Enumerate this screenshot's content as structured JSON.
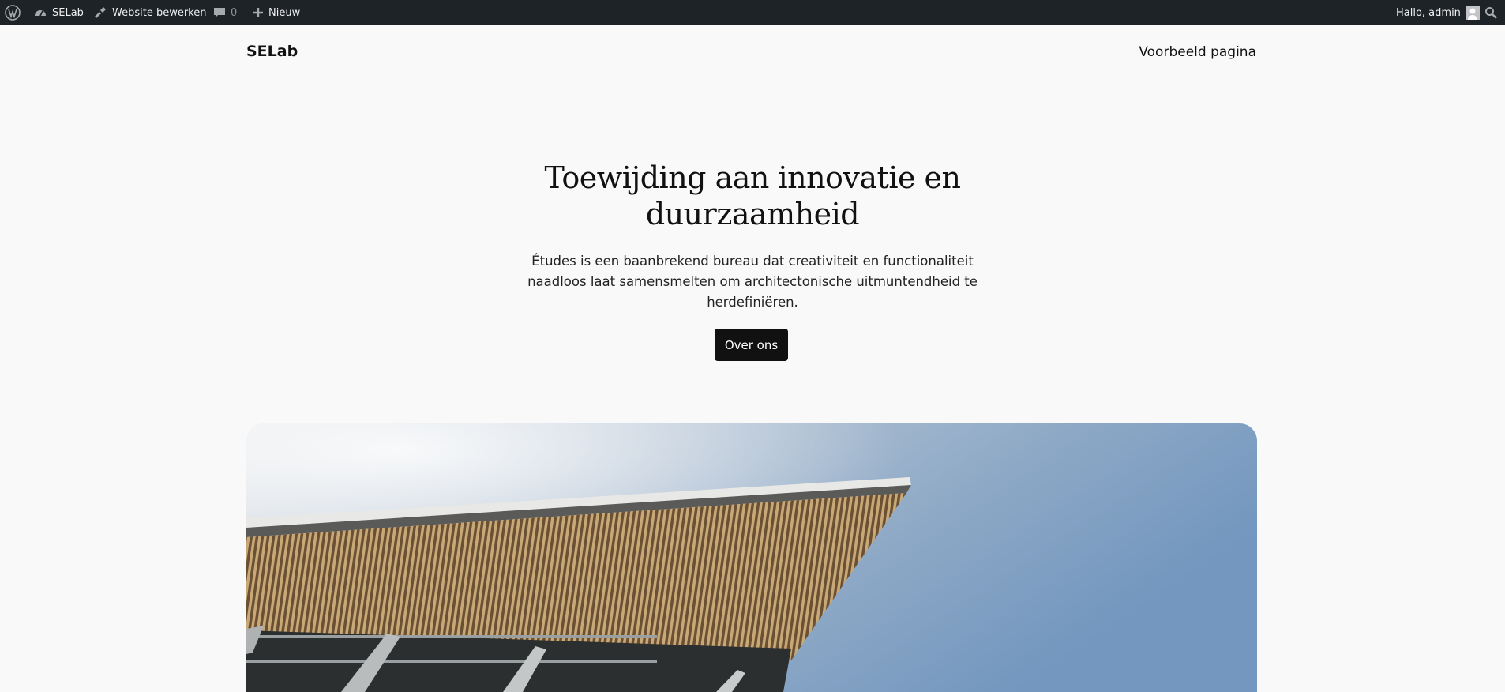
{
  "adminbar": {
    "site_name": "SELab",
    "edit_label": "Website bewerken",
    "comments_count": "0",
    "new_label": "Nieuw",
    "greeting": "Hallo, admin"
  },
  "header": {
    "site_title": "SELab",
    "nav_items": [
      "Voorbeeld pagina"
    ]
  },
  "hero": {
    "title": "Toewijding aan innovatie en duurzaamheid",
    "text": "Études is een baanbrekend bureau dat creativiteit en functionaliteit naadloos laat samensmelten om architectonische uitmuntendheid te herdefiniëren.",
    "button_label": "Over ons"
  },
  "colors": {
    "adminbar_bg": "#1d2327",
    "page_bg": "#f9f9f9",
    "button_bg": "#111111",
    "sky": "#8aa6c8"
  },
  "icons": [
    "wordpress-logo-icon",
    "dashboard-icon",
    "brush-icon",
    "comment-icon",
    "plus-icon",
    "avatar-icon",
    "search-icon"
  ]
}
